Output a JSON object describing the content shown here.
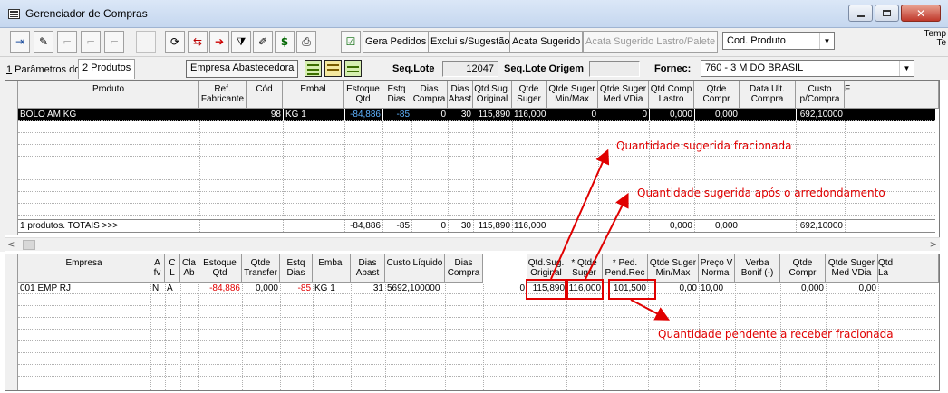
{
  "window": {
    "title": "Gerenciador de Compras"
  },
  "toolbar": {
    "gera_pedidos": "Gera Pedidos",
    "exclui_sugestao": "Exclui s/Sugestão",
    "acata_sugerido": "Acata Sugerido",
    "acata_lastro": "Acata Sugerido Lastro/Palete",
    "select_value": "Cod. Produto",
    "tempo_1": "Temp",
    "tempo_2": "Te"
  },
  "params": {
    "tab1_num": "1",
    "tab1_label": " Parâmetros do Lote",
    "tab2_num": "2",
    "tab2_label": " Produtos",
    "empresa_btn": "Empresa Abastecedora",
    "seq_lote_label": "Seq.Lote",
    "seq_lote_value": "12047",
    "seq_lote_origem_label": "Seq.Lote Origem",
    "seq_lote_origem_value": "",
    "fornec_label": "Fornec:",
    "fornec_value": "760 - 3 M DO BRASIL"
  },
  "top_grid": {
    "headers": [
      "Produto",
      "Ref.\nFabricante",
      "Cód",
      "Embal",
      "Estoque\nQtd",
      "Estq\nDias",
      "Dias\nCompra",
      "Dias\nAbast",
      "Qtd.Sug.\nOriginal",
      "Qtde\nSuger",
      "Qtde Suger\nMin/Max",
      "Qtde Suger\nMed VDia",
      "Qtd Comp\nLastro",
      "Qtde\nCompr",
      "Data Ult.\nCompra",
      "Custo\np/Compra",
      "F"
    ],
    "row": {
      "produto": "BOLO AM KG",
      "ref": "",
      "cod": "98",
      "embal": "KG 1",
      "estoque": "-84,886",
      "estq_dias": "-85",
      "dias_compra": "0",
      "dias_abast": "30",
      "qtd_sug_original": "115,890",
      "qtde_suger": "116,000",
      "suger_minmax": "0",
      "suger_medvdia": "0",
      "comp_lastro": "0,000",
      "qtde_compr": "0,000",
      "data_ult": "",
      "custo": "692,10000"
    },
    "totals": {
      "label": "1 produtos. TOTAIS >>>",
      "estoque": "-84,886",
      "estq_dias": "-85",
      "dias_compra": "0",
      "dias_abast": "30",
      "qtd_sug_original": "115,890",
      "qtde_suger": "116,000",
      "comp_lastro": "0,000",
      "qtde_compr": "0,000",
      "custo": "692,10000"
    }
  },
  "bottom_grid": {
    "headers": [
      "Empresa",
      "A\nfv",
      "C\nL",
      "Cla\nAb",
      "Estoque\nQtd",
      "Qtde\nTransfer",
      "Estq\nDias",
      "Embal",
      "Dias\nAbast",
      "Custo Líquido",
      "Dias\nCompra",
      "Qtd.Sug.\nOriginal",
      "* Qtde\nSuger",
      "* Ped.\nPend.Rec",
      "Qtde Suger\nMin/Max",
      "Preço V\nNormal",
      "Verba\nBonif (-)",
      "Qtde\nCompr",
      "Qtde Suger\nMed VDia",
      "Qtd\nLa"
    ],
    "row": {
      "empresa": "001 EMP RJ",
      "afv": "N",
      "cl": "A",
      "cla_ab": "",
      "estoque": "-84,886",
      "transfer": "0,000",
      "estq_dias": "-85",
      "embal": "KG 1",
      "dias_abast": "31",
      "custo_liquido": "5692,100000",
      "dias_compra": "0",
      "qtd_sug_original": "115,890",
      "qtde_suger": "116,000",
      "ped_pend_rec": "101,500",
      "suger_minmax": "0,00",
      "preco_normal": "10,00",
      "verba": "",
      "qtde_compr": "0,000",
      "suger_medvdia": "0,00"
    }
  },
  "annotations": {
    "fracionada": "Quantidade sugerida fracionada",
    "arredondamento": "Quantidade sugerida após o arredondamento",
    "pendente": "Quantidade pendente a receber fracionada"
  },
  "colors": {
    "annotation_red": "#e00000",
    "selected_row": "#000000"
  }
}
